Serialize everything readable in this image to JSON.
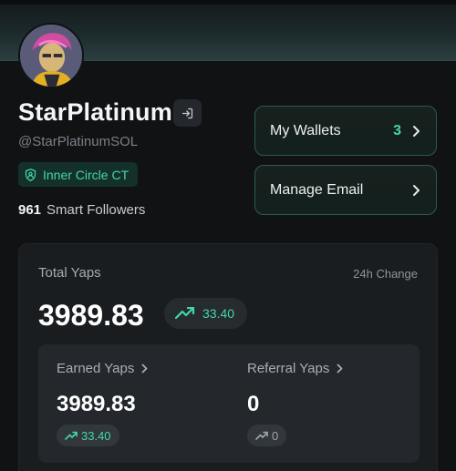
{
  "profile": {
    "display_name": "StarPlatinum",
    "handle": "@StarPlatinumSOL",
    "badge": "Inner Circle CT",
    "smart_followers_count": "961",
    "smart_followers_label": "Smart Followers"
  },
  "actions": {
    "wallets_label": "My Wallets",
    "wallets_count": "3",
    "email_label": "Manage Email"
  },
  "yaps": {
    "title": "Total Yaps",
    "change_label": "24h Change",
    "total": "3989.83",
    "total_change": "33.40",
    "earned": {
      "label": "Earned Yaps",
      "value": "3989.83",
      "change": "33.40"
    },
    "referral": {
      "label": "Referral Yaps",
      "value": "0",
      "change": "0"
    }
  },
  "colors": {
    "accent": "#44d6a8",
    "background": "#101214",
    "card": "#1a1d20"
  },
  "icons": [
    "logout-icon",
    "shield-user-icon",
    "chevron-right-icon",
    "trending-up-icon"
  ]
}
